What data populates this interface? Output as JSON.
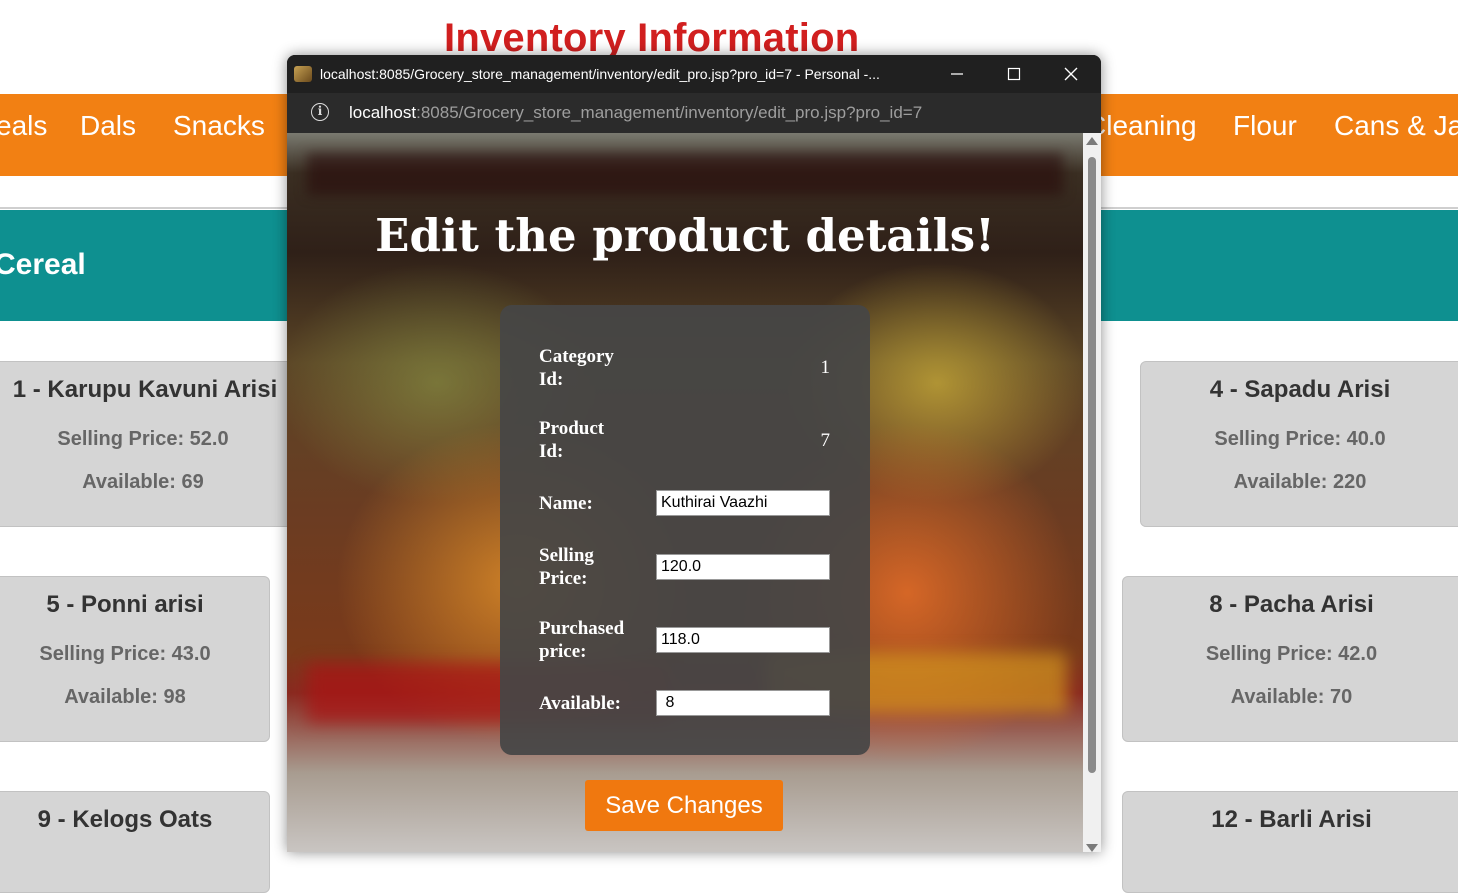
{
  "page": {
    "title": "Inventory Information",
    "nav": [
      "eals",
      "Dals",
      "Snacks",
      "Cleaning",
      "Flour",
      "Cans & Ja"
    ],
    "category": "Cereal",
    "cards": [
      {
        "title": "1 - Karupu Kavuni Arisi",
        "price": "Selling Price: 52.0",
        "available": "Available: 69"
      },
      {
        "title": "4 - Sapadu Arisi",
        "price": "Selling Price: 40.0",
        "available": "Available: 220"
      },
      {
        "title": "5 - Ponni arisi",
        "price": "Selling Price: 43.0",
        "available": "Available: 98"
      },
      {
        "title": "8 - Pacha Arisi",
        "price": "Selling Price: 42.0",
        "available": "Available: 70"
      },
      {
        "title": "9 - Kelogs Oats"
      },
      {
        "title": "12 - Barli Arisi"
      }
    ]
  },
  "popup": {
    "window_title": "localhost:8085/Grocery_store_management/inventory/edit_pro.jsp?pro_id=7 - Personal -...",
    "url_host": "localhost",
    "url_rest": ":8085/Grocery_store_management/inventory/edit_pro.jsp?pro_id=7",
    "heading": "Edit the product details!",
    "form": {
      "category_label": "Category Id:",
      "category_value": "1",
      "product_label": "Product Id:",
      "product_value": "7",
      "name_label": "Name:",
      "name_value": "Kuthirai Vaazhi",
      "selling_label": "Selling Price:",
      "selling_value": "120.0",
      "purchased_label": "Purchased price:",
      "purchased_value": "118.0",
      "available_label": "Available:",
      "available_value": " 8"
    },
    "save_label": "Save Changes"
  }
}
